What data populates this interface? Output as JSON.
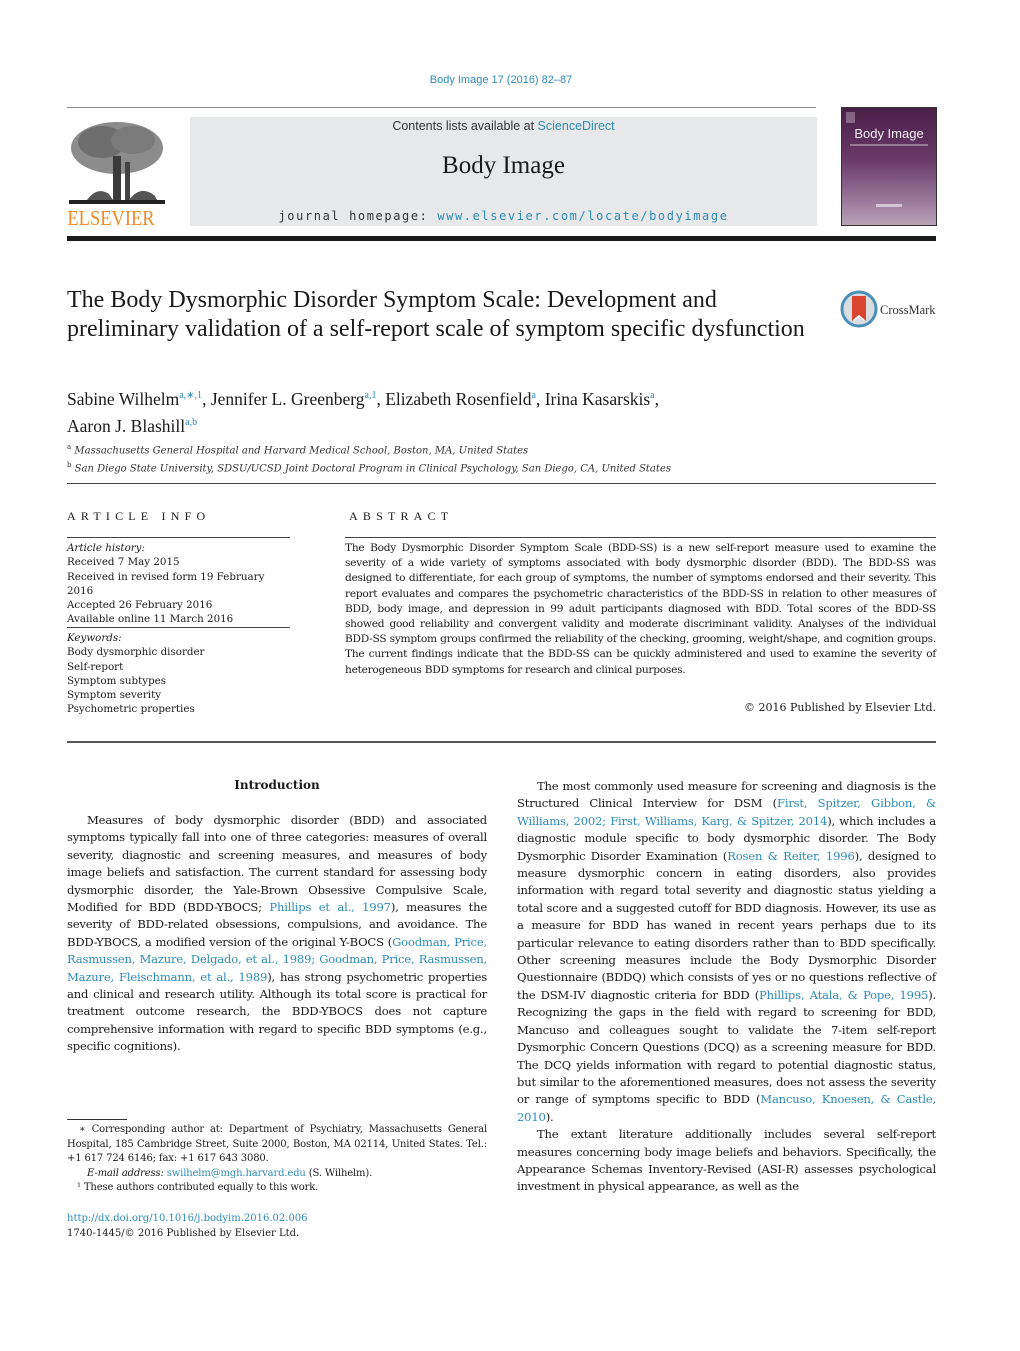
{
  "header": {
    "journal_ref": "Body Image 17 (2016) 82–87",
    "contents_prefix": "Contents lists available at ",
    "contents_link": "ScienceDirect",
    "journal_title": "Body Image",
    "homepage_prefix": "journal homepage: ",
    "homepage_link": "www.elsevier.com/locate/bodyimage",
    "publisher_wordmark": "ELSEVIER",
    "cover_title": "Body Image",
    "colors": {
      "link": "#2e8bb5",
      "elsevier_orange": "#f08a24",
      "masthead_gray": "#e7e8ea",
      "cover_purple": "#4a1f47"
    }
  },
  "article": {
    "title": "The Body Dysmorphic Disorder Symptom Scale: Development and preliminary validation of a self-report scale of symptom specific dysfunction",
    "crossmark_label": "CrossMark",
    "authors": [
      {
        "name": "Sabine Wilhelm",
        "sup": "a,∗,1",
        "sep": ", "
      },
      {
        "name": "Jennifer L. Greenberg",
        "sup": "a,1",
        "sep": ", "
      },
      {
        "name": "Elizabeth Rosenfield",
        "sup": "a",
        "sep": ", "
      },
      {
        "name": "Irina Kasarskis",
        "sup": "a",
        "sep": ","
      },
      {
        "name": "Aaron J. Blashill",
        "sup": "a,b",
        "sep": ""
      }
    ],
    "affiliations": [
      {
        "mark": "a",
        "text": "Massachusetts General Hospital and Harvard Medical School, Boston, MA, United States"
      },
      {
        "mark": "b",
        "text": "San Diego State University, SDSU/UCSD Joint Doctoral Program in Clinical Psychology, San Diego, CA, United States"
      }
    ]
  },
  "article_info": {
    "heading": "ARTICLE INFO",
    "history_label": "Article history:",
    "history": [
      "Received 7 May 2015",
      "Received in revised form 19 February 2016",
      "Accepted 26 February 2016",
      "Available online 11 March 2016"
    ],
    "keywords_label": "Keywords:",
    "keywords": [
      "Body dysmorphic disorder",
      "Self-report",
      "Symptom subtypes",
      "Symptom severity",
      "Psychometric properties"
    ]
  },
  "abstract": {
    "heading": "ABSTRACT",
    "text": "The Body Dysmorphic Disorder Symptom Scale (BDD-SS) is a new self-report measure used to examine the severity of a wide variety of symptoms associated with body dysmorphic disorder (BDD). The BDD-SS was designed to differentiate, for each group of symptoms, the number of symptoms endorsed and their severity. This report evaluates and compares the psychometric characteristics of the BDD-SS in relation to other measures of BDD, body image, and depression in 99 adult participants diagnosed with BDD. Total scores of the BDD-SS showed good reliability and convergent validity and moderate discriminant validity. Analyses of the individual BDD-SS symptom groups confirmed the reliability of the checking, grooming, weight/shape, and cognition groups. The current findings indicate that the BDD-SS can be quickly administered and used to examine the severity of heterogeneous BDD symptoms for research and clinical purposes.",
    "copyright": "© 2016 Published by Elsevier Ltd."
  },
  "body": {
    "intro_heading": "Introduction",
    "left_paragraph": [
      {
        "t": "Measures of body dysmorphic disorder (BDD) and associated symptoms typically fall into one of three categories: measures of overall severity, diagnostic and screening measures, and measures of body image beliefs and satisfaction. The current standard for assessing body dysmorphic disorder, the Yale-Brown Obsessive Compulsive Scale, Modified for BDD (BDD-YBOCS; "
      },
      {
        "c": "Phillips et al., 1997"
      },
      {
        "t": "), measures the severity of BDD-related obsessions, compulsions, and avoidance. The BDD-YBOCS, a modified version of the original Y-BOCS ("
      },
      {
        "c": "Goodman, Price, Rasmussen, Mazure, Delgado, et al., 1989; Goodman, Price, Rasmussen, Mazure, Fleischmann, et al., 1989"
      },
      {
        "t": "), has strong psychometric properties and clinical and research utility. Although its total score is practical for treatment outcome research, the BDD-YBOCS does not capture comprehensive information with regard to specific BDD symptoms (e.g., specific cognitions)."
      }
    ],
    "right_paragraph_1": [
      {
        "t": "The most commonly used measure for screening and diagnosis is the Structured Clinical Interview for DSM ("
      },
      {
        "c": "First, Spitzer, Gibbon, & Williams, 2002; First, Williams, Karg, & Spitzer, 2014"
      },
      {
        "t": "), which includes a diagnostic module specific to body dysmorphic disorder. The Body Dysmorphic Disorder Examination ("
      },
      {
        "c": "Rosen & Reiter, 1996"
      },
      {
        "t": "), designed to measure dysmorphic concern in eating disorders, also provides information with regard total severity and diagnostic status yielding a total score and a suggested cutoff for BDD diagnosis. However, its use as a measure for BDD has waned in recent years perhaps due to its particular relevance to eating disorders rather than to BDD specifically. Other screening measures include the Body Dysmorphic Disorder Questionnaire (BDDQ) which consists of yes or no questions reflective of the DSM-IV diagnostic criteria for BDD ("
      },
      {
        "c": "Phillips, Atala, & Pope, 1995"
      },
      {
        "t": "). Recognizing the gaps in the field with regard to screening for BDD, Mancuso and colleagues sought to validate the 7-item self-report Dysmorphic Concern Questions (DCQ) as a screening measure for BDD. The DCQ yields information with regard to potential diagnostic status, but similar to the aforementioned measures, does not assess the severity or range of symptoms specific to BDD ("
      },
      {
        "c": "Mancuso, Knoesen, & Castle, 2010"
      },
      {
        "t": ")."
      }
    ],
    "right_paragraph_2": [
      {
        "t": "The extant literature additionally includes several self-report measures concerning body image beliefs and behaviors. Specifically, the Appearance Schemas Inventory-Revised (ASI-R) assesses psychological investment in physical appearance, as well as the"
      }
    ]
  },
  "footnotes": {
    "corresponding": "∗  Corresponding author at: Department of Psychiatry, Massachusetts General Hospital, 185 Cambridge Street, Suite 2000, Boston, MA 02114, United States. Tel.: +1 617 724 6146; fax: +1 617 643 3080.",
    "email_label": "E-mail address: ",
    "email": "swilhelm@mgh.harvard.edu",
    "email_suffix": " (S. Wilhelm).",
    "equal_contrib": "¹  These authors contributed equally to this work.",
    "doi": "http://dx.doi.org/10.1016/j.bodyim.2016.02.006",
    "issn_line": "1740-1445/© 2016 Published by Elsevier Ltd."
  }
}
